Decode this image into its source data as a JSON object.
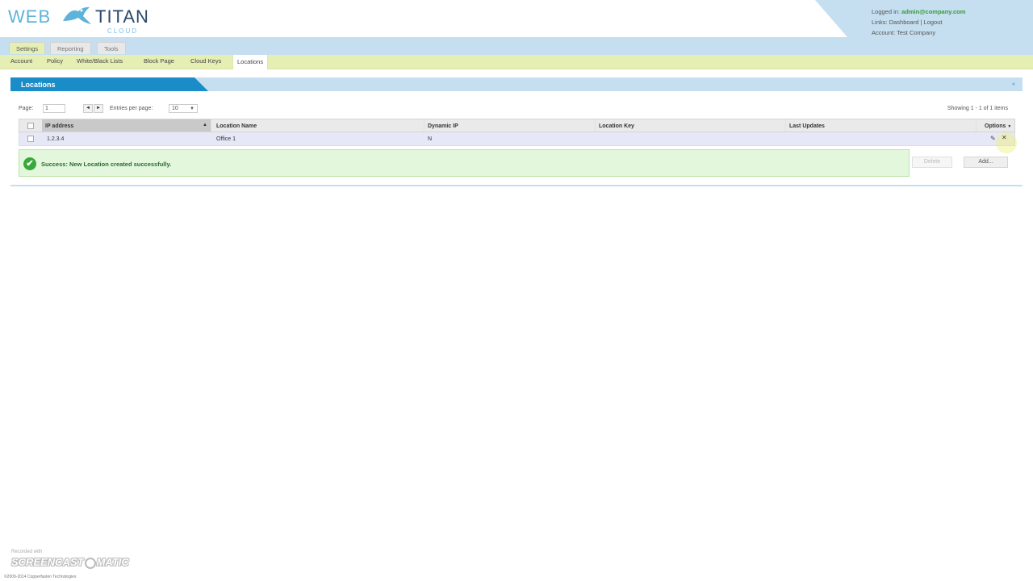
{
  "logo": {
    "part1": "WEB",
    "part2": "TITAN",
    "sub": "CLOUD"
  },
  "account": {
    "logged_label": "Logged in:",
    "email": "admin@company.com",
    "links_label": "Links:",
    "dashboard": "Dashboard",
    "separator": "|",
    "logout": "Logout",
    "account_line": "Account: Test Company"
  },
  "nav1": {
    "tabs": [
      "Settings",
      "Reporting",
      "Tools"
    ],
    "active": "Settings"
  },
  "nav2": {
    "tabs": [
      "Account",
      "Policy",
      "White/Black Lists",
      "Block Page",
      "Cloud Keys",
      "Locations"
    ],
    "active": "Locations"
  },
  "panel": {
    "title": "Locations",
    "collapse_icon": "collapse-icon",
    "pager": {
      "page_label": "Page:",
      "page_value": "1",
      "prev_icon": "◄",
      "next_icon": "►",
      "entries_label": "Entries per page:",
      "entries_value": "10",
      "caret": "▼"
    },
    "showing": "Showing 1 - 1 of 1 items"
  },
  "table": {
    "columns": [
      "IP address",
      "Location Name",
      "Dynamic IP",
      "Location Key",
      "Last Updates",
      "Options"
    ],
    "sort_icon": "▲",
    "options_caret": "▼",
    "rows": [
      {
        "ip": "1.2.3.4",
        "name": "Office 1",
        "dynamic": "N",
        "key": "",
        "updated": ""
      }
    ],
    "row_icons": [
      "edit-icon",
      "delete-icon"
    ]
  },
  "message": {
    "icon": "✔",
    "text": "Success: New Location created successfully."
  },
  "buttons": {
    "delete": "Delete",
    "add": "Add..."
  },
  "watermark": {
    "recorded": "Recorded with",
    "brand_a": "SCREENCAST",
    "brand_b": "MATIC",
    "copyright": "©2009-2014 Copperfasten Technologies"
  },
  "colors": {
    "accent_blue": "#1a8cc8",
    "light_blue": "#c5dff0",
    "nav_green": "#e5efb4",
    "row_highlight": "#e6e8f7",
    "success_bg": "#e3f7dd"
  }
}
